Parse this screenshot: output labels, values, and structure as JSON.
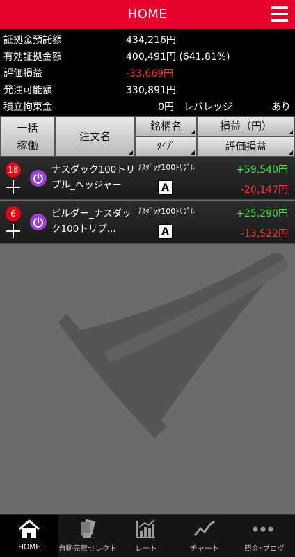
{
  "header": {
    "title": "HOME"
  },
  "summary": [
    {
      "label": "証拠金預託額",
      "value": "434,216円"
    },
    {
      "label": "有効証拠金額",
      "value": "400,491円 (641.81%)"
    },
    {
      "label": "評価損益",
      "value": "-33,669円"
    },
    {
      "label": "発注可能額",
      "value": "330,891円"
    },
    {
      "label": "積立拘束金",
      "value": "0円",
      "extra1": "レバレッジ",
      "extra2": "あり"
    }
  ],
  "table_header": {
    "ikkatsu_line1": "一括",
    "ikkatsu_line2": "稼働",
    "order_name": "注文名",
    "ticker": "銘柄名",
    "type": "ﾀｲﾌﾟ",
    "profit": "損益（円）",
    "eval": "評価損益"
  },
  "orders": [
    {
      "count": "18",
      "name_line1": "ナスダック100トリ",
      "name_line2": "プル_ヘッジャー",
      "ticker": "ﾅｽﾀﾞｯｸ100ﾄﾘﾌﾟﾙ",
      "type": "A",
      "profit": "+59,540円",
      "eval": "-20,147円"
    },
    {
      "count": "6",
      "name_line1": "ビルダー_ナスダッ",
      "name_line2": "ク100トリプ...",
      "ticker": "ﾅｽﾀﾞｯｸ100ﾄﾘﾌﾟﾙ",
      "type": "A",
      "profit": "+25,290円",
      "eval": "-13,522円"
    }
  ],
  "nav": [
    {
      "label": "HOME",
      "icon": "home-icon"
    },
    {
      "label": "自動売買セレクト",
      "icon": "cards-icon"
    },
    {
      "label": "レート",
      "icon": "bar-chart-icon"
    },
    {
      "label": "チャート",
      "icon": "line-chart-icon"
    },
    {
      "label": "照会･ブログ",
      "icon": "more-dots-icon"
    }
  ],
  "colors": {
    "header": "#e6002d",
    "profit": "#3ee03e",
    "loss": "#ff3030",
    "power": "#9b3fd8"
  }
}
